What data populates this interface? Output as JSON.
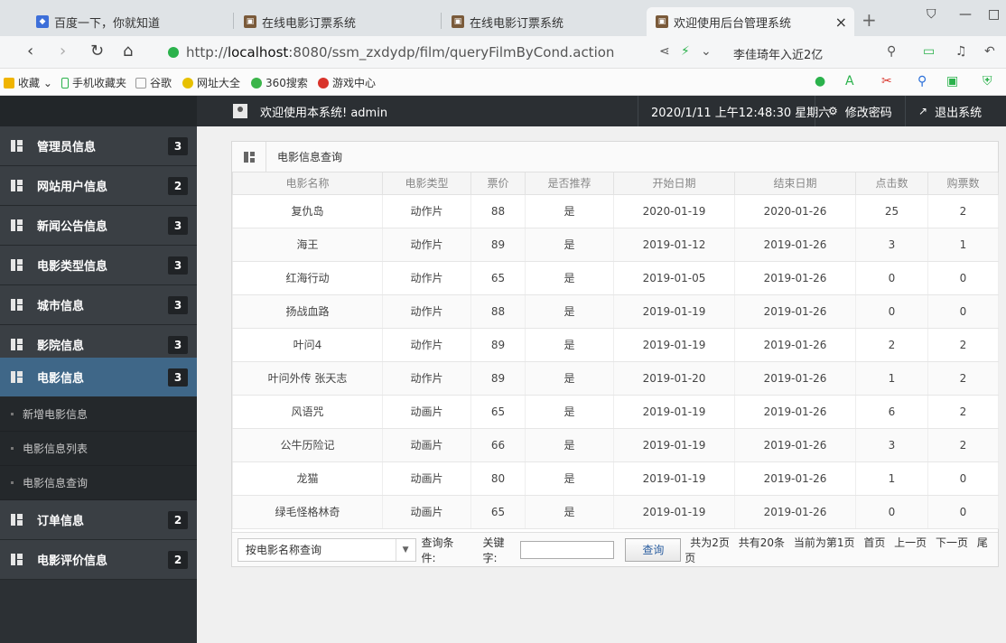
{
  "browser": {
    "tabs": [
      {
        "label": "百度一下，你就知道",
        "active": false
      },
      {
        "label": "在线电影订票系统",
        "active": false
      },
      {
        "label": "在线电影订票系统",
        "active": false
      },
      {
        "label": "欢迎使用后台管理系统",
        "active": true
      }
    ],
    "url_prefix": "http://",
    "url_host": "localhost",
    "url_rest": ":8080/ssm_zxdydp/film/queryFilmByCond.action",
    "search_hint": "李佳琦年入近2亿"
  },
  "bookmarks": [
    "收藏",
    "手机收藏夹",
    "谷歌",
    "网址大全",
    "360搜索",
    "游戏中心"
  ],
  "header": {
    "welcome": "欢迎使用本系统! admin",
    "datetime": "2020/1/11 上午12:48:30 星期六",
    "change_password": "修改密码",
    "logout": "退出系统"
  },
  "sidebar": {
    "items": [
      {
        "label": "管理员信息",
        "count": "3"
      },
      {
        "label": "网站用户信息",
        "count": "2"
      },
      {
        "label": "新闻公告信息",
        "count": "3"
      },
      {
        "label": "电影类型信息",
        "count": "3"
      },
      {
        "label": "城市信息",
        "count": "3"
      },
      {
        "label": "影院信息",
        "count": "3"
      },
      {
        "label": "电影信息",
        "count": "3"
      },
      {
        "label": "订单信息",
        "count": "2"
      },
      {
        "label": "电影评价信息",
        "count": "2"
      }
    ],
    "subitems": [
      "新增电影信息",
      "电影信息列表",
      "电影信息查询"
    ]
  },
  "panel": {
    "title": "电影信息查询",
    "columns": [
      "电影名称",
      "电影类型",
      "票价",
      "是否推荐",
      "开始日期",
      "结束日期",
      "点击数",
      "购票数"
    ],
    "rows": [
      [
        "复仇岛",
        "动作片",
        "88",
        "是",
        "2020-01-19",
        "2020-01-26",
        "25",
        "2"
      ],
      [
        "海王",
        "动作片",
        "89",
        "是",
        "2019-01-12",
        "2019-01-26",
        "3",
        "1"
      ],
      [
        "红海行动",
        "动作片",
        "65",
        "是",
        "2019-01-05",
        "2019-01-26",
        "0",
        "0"
      ],
      [
        "扬战血路",
        "动作片",
        "88",
        "是",
        "2019-01-19",
        "2019-01-26",
        "0",
        "0"
      ],
      [
        "叶问4",
        "动作片",
        "89",
        "是",
        "2019-01-19",
        "2019-01-26",
        "2",
        "2"
      ],
      [
        "叶问外传 张天志",
        "动作片",
        "89",
        "是",
        "2019-01-20",
        "2019-01-26",
        "1",
        "2"
      ],
      [
        "风语咒",
        "动画片",
        "65",
        "是",
        "2019-01-19",
        "2019-01-26",
        "6",
        "2"
      ],
      [
        "公牛历险记",
        "动画片",
        "66",
        "是",
        "2019-01-19",
        "2019-01-26",
        "3",
        "2"
      ],
      [
        "龙猫",
        "动画片",
        "80",
        "是",
        "2019-01-19",
        "2019-01-26",
        "1",
        "0"
      ],
      [
        "绿毛怪格林奇",
        "动画片",
        "65",
        "是",
        "2019-01-19",
        "2019-01-26",
        "0",
        "0"
      ]
    ],
    "query_select": "按电影名称查询",
    "cond_label": "查询条件:",
    "kw_label": "关键字:",
    "query_btn": "查询",
    "pager": {
      "total_pages": "共为2页",
      "total_count": "共有20条",
      "current": "当前为第1页",
      "first": "首页",
      "prev": "上一页",
      "next": "下一页",
      "last": "尾页"
    }
  }
}
